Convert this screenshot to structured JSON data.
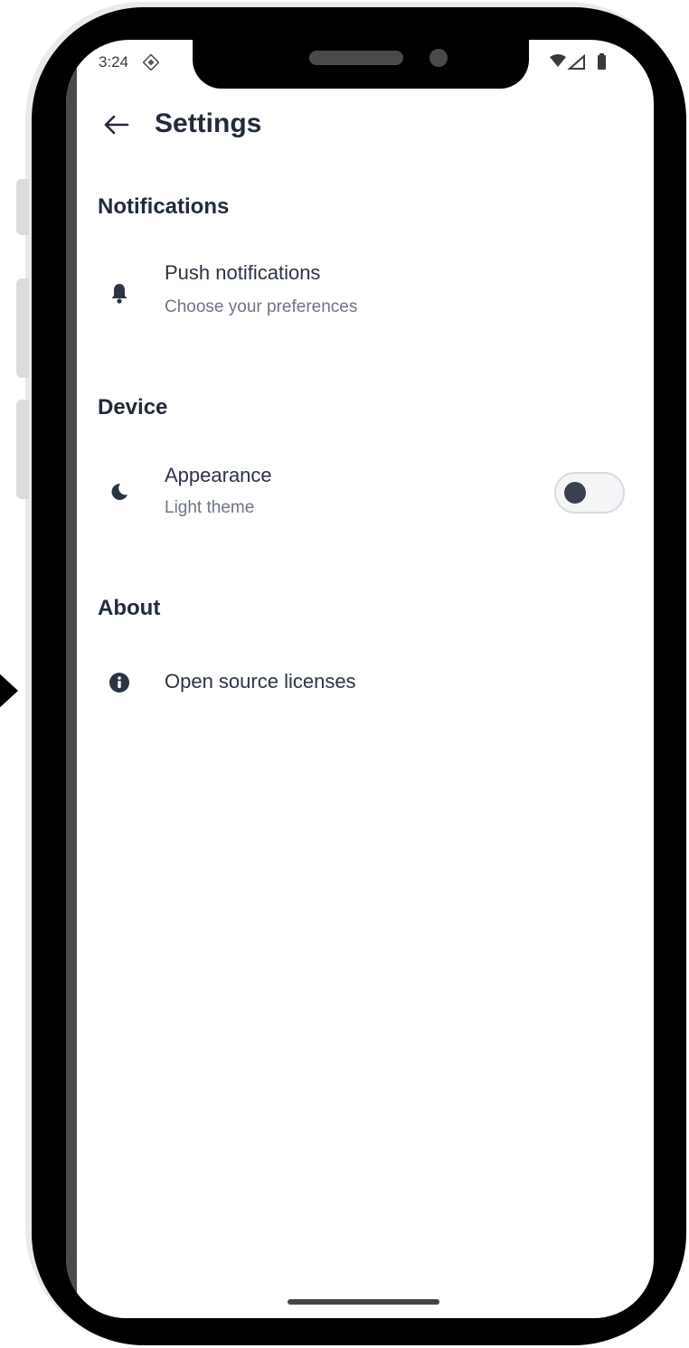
{
  "status_bar": {
    "time": "3:24",
    "sync_icon": "sync-diamond-icon",
    "wifi_icon": "wifi-icon",
    "signal_icon": "signal-icon",
    "battery_icon": "battery-icon"
  },
  "app_bar": {
    "back_icon": "arrow-left-icon",
    "title": "Settings"
  },
  "sections": [
    {
      "header": "Notifications",
      "items": [
        {
          "icon": "bell-icon",
          "title": "Push notifications",
          "subtitle": "Choose your preferences"
        }
      ]
    },
    {
      "header": "Device",
      "items": [
        {
          "icon": "moon-icon",
          "title": "Appearance",
          "subtitle": "Light theme",
          "toggle": {
            "on": false
          }
        }
      ]
    },
    {
      "header": "About",
      "items": [
        {
          "icon": "info-icon",
          "title": "Open source licenses"
        }
      ]
    }
  ],
  "colors": {
    "text_primary": "#222b3a",
    "text_secondary": "#6e7682",
    "icon": "#2b3442",
    "toggle_knob": "#39404f"
  }
}
